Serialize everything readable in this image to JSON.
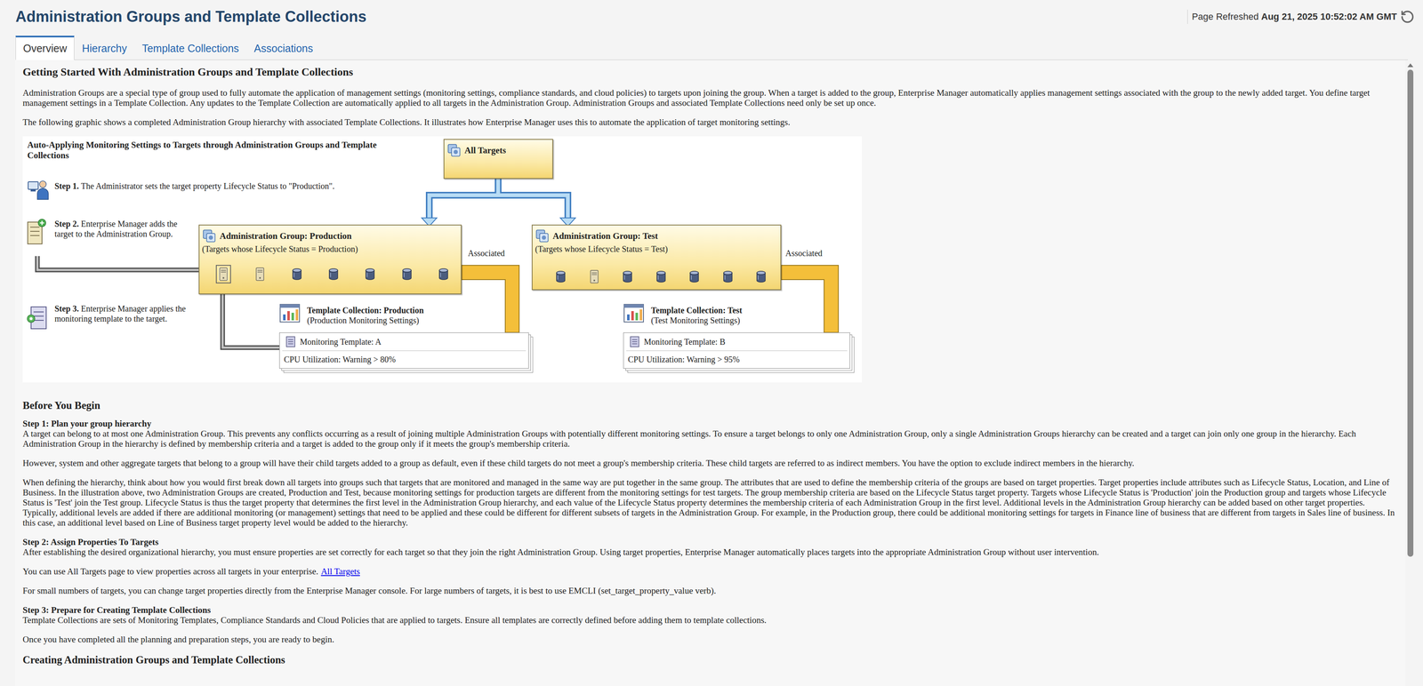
{
  "header": {
    "title": "Administration Groups and Template Collections",
    "refreshed_label": "Page Refreshed",
    "refreshed_time": "Aug 21, 2025 10:52:02 AM GMT"
  },
  "tabs": [
    {
      "label": "Overview",
      "selected": true
    },
    {
      "label": "Hierarchy",
      "selected": false
    },
    {
      "label": "Template Collections",
      "selected": false
    },
    {
      "label": "Associations",
      "selected": false
    }
  ],
  "intro": {
    "heading": "Getting Started With Administration Groups and Template Collections",
    "paragraphs": [
      "Administration Groups are a special type of group used to fully automate the application of management settings (monitoring settings, compliance standards, and cloud policies) to targets upon joining the group. When a target is added to the group, Enterprise Manager automatically applies management settings associated with the group to the newly added target. You define target management settings in a Template Collection. Any updates to the Template Collection are automatically applied to all targets in the Administration Group. Administration Groups and associated Template Collections need only be set up once.",
      "The following graphic shows a completed Administration Group hierarchy with associated Template Collections. It illustrates how Enterprise Manager uses this to automate the application of target monitoring settings."
    ]
  },
  "diagram": {
    "title": "Auto-Applying Monitoring Settings to Targets through Administration Groups and Template Collections",
    "all_targets": "All Targets",
    "steps": [
      {
        "label": "Step 1.",
        "text": "The Administrator sets the target property Lifecycle Status to \"Production\"."
      },
      {
        "label": "Step 2.",
        "text": "Enterprise Manager adds the target to the Administration Group."
      },
      {
        "label": "Step 3.",
        "text": "Enterprise Manager applies the monitoring template to the target."
      }
    ],
    "groups": [
      {
        "name": "Administration Group: Production",
        "criteria": "(Targets whose Lifecycle Status = Production)",
        "association": "Associated",
        "targets": [
          {
            "kind": "host",
            "selected": true
          },
          {
            "kind": "host",
            "selected": false
          },
          {
            "kind": "database",
            "selected": false
          },
          {
            "kind": "database",
            "selected": false
          },
          {
            "kind": "database",
            "selected": false
          },
          {
            "kind": "database",
            "selected": false
          },
          {
            "kind": "database",
            "selected": false
          }
        ],
        "collection": {
          "name": "Template Collection: Production",
          "description": "(Production Monitoring Settings)",
          "template": "Monitoring Template: A",
          "rule": "CPU Utilization: Warning > 80%"
        }
      },
      {
        "name": "Administration Group: Test",
        "criteria": "(Targets whose Lifecycle Status = Test)",
        "association": "Associated",
        "targets": [
          {
            "kind": "database",
            "selected": false
          },
          {
            "kind": "host",
            "selected": false
          },
          {
            "kind": "database",
            "selected": false
          },
          {
            "kind": "database",
            "selected": false
          },
          {
            "kind": "database",
            "selected": false
          },
          {
            "kind": "database",
            "selected": false
          },
          {
            "kind": "database",
            "selected": false
          }
        ],
        "collection": {
          "name": "Template Collection: Test",
          "description": "(Test Monitoring Settings)",
          "template": "Monitoring Template: B",
          "rule": "CPU Utilization: Warning > 95%"
        }
      }
    ]
  },
  "before": {
    "heading": "Before You Begin",
    "steps": [
      {
        "title": "Step 1: Plan your group hierarchy",
        "paragraphs": [
          {
            "text": "A target can belong to at most one Administration Group. This prevents any conflicts occurring as a result of joining multiple Administration Groups with potentially different monitoring settings. To ensure a target belongs to only one Administration Group, only a single Administration Groups hierarchy can be created and a target can join only one group in the hierarchy. Each Administration Group in the hierarchy is defined by membership criteria and a target is added to the group only if it meets the group's membership criteria."
          },
          {
            "text": "However, system and other aggregate targets that belong to a group will have their child targets added to a group as default, even if these child targets do not meet a group's membership criteria. These child targets are referred to as indirect members. You have the option to exclude indirect members in the hierarchy."
          },
          {
            "text": "When defining the hierarchy, think about how you would first break down all targets into groups such that targets that are monitored and managed in the same way are put together in the same group. The attributes that are used to define the membership criteria of the groups are based on target properties. Target properties include attributes such as Lifecycle Status, Location, and Line of Business. In the illustration above, two Administration Groups are created, Production and Test, because monitoring settings for production targets are different from the monitoring settings for test targets. The group membership criteria are based on the Lifecycle Status target property. Targets whose Lifecycle Status is 'Production' join the Production group and targets whose Lifecycle Status is 'Test' join the Test group. Lifecycle Status is thus the target property that determines the first level in the Administration Group hierarchy, and each value of the Lifecycle Status property determines the membership criteria of each Administration Group in the first level. Additional levels in the Administration Group hierarchy can be added based on other target properties. Typically, additional levels are added if there are additional monitoring (or management) settings that need to be applied and these could be different for different subsets of targets in the Administration Group. For example, in the Production group, there could be additional monitoring settings for targets in Finance line of business that are different from targets in Sales line of business. In this case, an additional level based on Line of Business target property level would be added to the hierarchy."
          }
        ]
      },
      {
        "title": "Step 2: Assign Properties To Targets",
        "paragraphs": [
          {
            "text": "After establishing the desired organizational hierarchy, you must ensure properties are set correctly for each target so that they join the right Administration Group. Using target properties, Enterprise Manager automatically places targets into the appropriate Administration Group without user intervention."
          },
          {
            "text": "You can use All Targets page to view properties across all targets in your enterprise.",
            "link": "All Targets"
          },
          {
            "text": "For small numbers of targets, you can change target properties directly from the Enterprise Manager console. For large numbers of targets, it is best to use EMCLI (set_target_property_value verb)."
          }
        ]
      },
      {
        "title": "Step 3: Prepare for Creating Template Collections",
        "paragraphs": [
          {
            "text": "Template Collections are sets of Monitoring Templates, Compliance Standards and Cloud Policies that are applied to targets. Ensure all templates are correctly defined before adding them to template collections."
          }
        ]
      }
    ],
    "closing": "Once you have completed all the planning and preparation steps, you are ready to begin."
  },
  "next_heading": "Creating Administration Groups and Template Collections",
  "scrollbar": {
    "level": 0.79
  }
}
